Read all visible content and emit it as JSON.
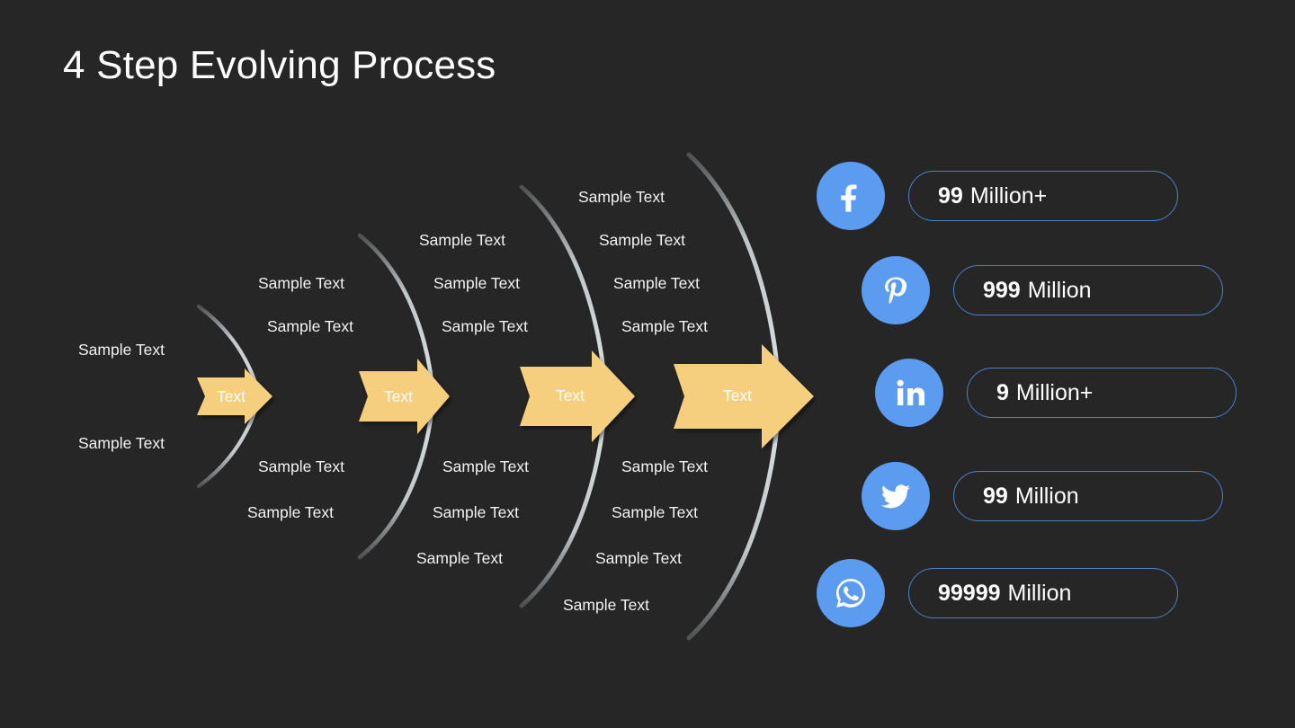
{
  "slide": {
    "title": "4 Step Evolving Process",
    "background_color": "#262626",
    "arrow_color": "#f5ce7e",
    "arc_color": "#c9cfd2",
    "accent_blue": "#5b9bf0",
    "pill_border_color": "#4d7fc4"
  },
  "process": {
    "steps": [
      {
        "name": "step-1",
        "arrow_label": "Text",
        "labels_above": [
          "Sample Text"
        ],
        "labels_below": [
          "Sample Text"
        ]
      },
      {
        "name": "step-2",
        "arrow_label": "Text",
        "labels_above": [
          "Sample Text",
          "Sample Text"
        ],
        "labels_below": [
          "Sample Text",
          "Sample Text"
        ]
      },
      {
        "name": "step-3",
        "arrow_label": "Text",
        "labels_above": [
          "Sample Text",
          "Sample Text",
          "Sample Text"
        ],
        "labels_below": [
          "Sample Text",
          "Sample Text",
          "Sample Text"
        ]
      },
      {
        "name": "step-4",
        "arrow_label": "Text",
        "labels_above": [
          "Sample Text",
          "Sample Text",
          "Sample Text",
          "Sample Text"
        ],
        "labels_below": [
          "Sample Text",
          "Sample Text",
          "Sample Text",
          "Sample Text"
        ]
      }
    ]
  },
  "social": {
    "rows": [
      {
        "network": "facebook",
        "icon": "facebook-icon",
        "value": "99",
        "unit": "Million+"
      },
      {
        "network": "pinterest",
        "icon": "pinterest-icon",
        "value": "999",
        "unit": "Million"
      },
      {
        "network": "linkedin",
        "icon": "linkedin-icon",
        "value": "9",
        "unit": "Million+"
      },
      {
        "network": "twitter",
        "icon": "twitter-icon",
        "value": "99",
        "unit": "Million"
      },
      {
        "network": "whatsapp",
        "icon": "whatsapp-icon",
        "value": "99999",
        "unit": "Million"
      }
    ]
  }
}
